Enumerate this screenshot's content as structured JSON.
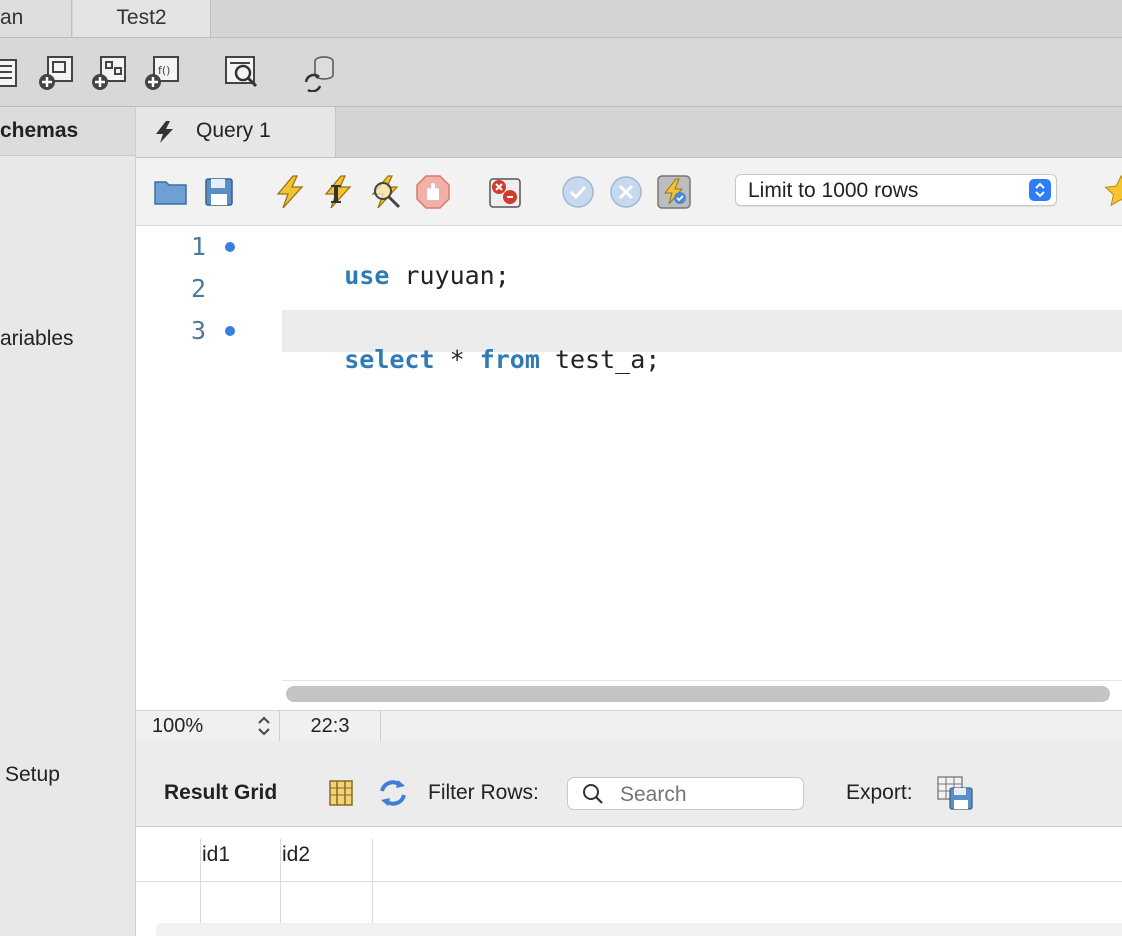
{
  "connection_tabs": [
    {
      "label": "an"
    },
    {
      "label": "Test2"
    }
  ],
  "sidebar": {
    "header": "chemas",
    "items": [
      "ariables",
      "Setup"
    ]
  },
  "query_tab": {
    "label": "Query 1",
    "icon": "lightning-icon"
  },
  "editor_toolbar": {
    "limit_select": "Limit to 1000 rows"
  },
  "editor": {
    "lines": [
      {
        "number": "1",
        "tokens": [
          {
            "t": "use",
            "kw": true
          },
          {
            "t": " ruyuan;",
            "kw": false
          }
        ]
      },
      {
        "number": "2",
        "tokens": []
      },
      {
        "number": "3",
        "tokens": [
          {
            "t": "select",
            "kw": true
          },
          {
            "t": " * ",
            "kw": false
          },
          {
            "t": "from",
            "kw": true
          },
          {
            "t": " test_a;",
            "kw": false
          }
        ]
      }
    ]
  },
  "status": {
    "zoom": "100%",
    "cursor": "22:3"
  },
  "result_toolbar": {
    "result_grid_label": "Result Grid",
    "filter_label": "Filter Rows:",
    "search_placeholder": "Search",
    "export_label": "Export:"
  },
  "result_grid": {
    "columns": [
      "id1",
      "id2"
    ]
  },
  "colors": {
    "keyword": "#2e7bb8",
    "accent": "#2f7cf6",
    "line_numbers": "#4e7a99"
  }
}
